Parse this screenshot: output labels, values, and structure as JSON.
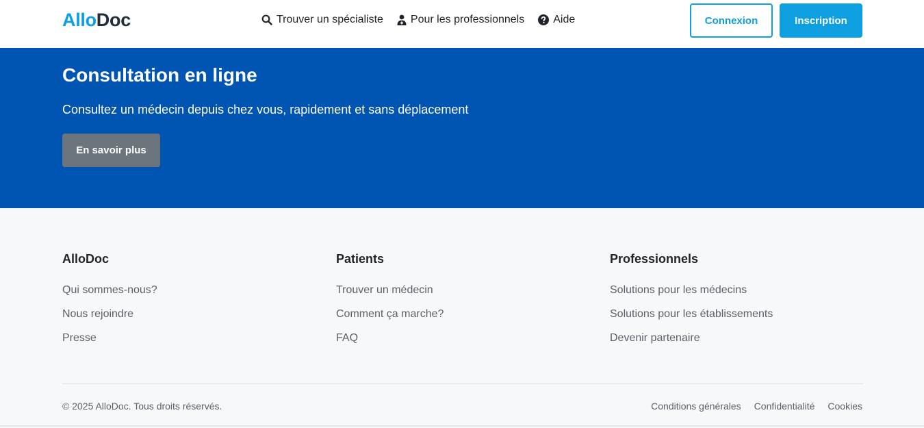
{
  "brand": {
    "part1": "Allo",
    "part2": "Doc"
  },
  "nav": {
    "find_specialist": "Trouver un spécialiste",
    "for_professionals": "Pour les professionnels",
    "help": "Aide"
  },
  "auth": {
    "login": "Connexion",
    "signup": "Inscription"
  },
  "hero": {
    "title": "Consultation en ligne",
    "subtitle": "Consultez un médecin depuis chez vous, rapidement et sans déplacement",
    "cta": "En savoir plus"
  },
  "footer": {
    "columns": [
      {
        "title": "AlloDoc",
        "links": [
          "Qui sommes-nous?",
          "Nous rejoindre",
          "Presse"
        ]
      },
      {
        "title": "Patients",
        "links": [
          "Trouver un médecin",
          "Comment ça marche?",
          "FAQ"
        ]
      },
      {
        "title": "Professionnels",
        "links": [
          "Solutions pour les médecins",
          "Solutions pour les établissements",
          "Devenir partenaire"
        ]
      }
    ],
    "copyright": "© 2025 AlloDoc. Tous droits réservés.",
    "legal": [
      "Conditions générales",
      "Confidentialité",
      "Cookies"
    ]
  },
  "colors": {
    "accent": "#0d9fe0",
    "hero_bg": "#0055b3",
    "grey_button": "#6c757d",
    "footer_bg": "#f7f8fa"
  },
  "icons": {
    "find_specialist": "search-icon",
    "for_professionals": "doctor-icon",
    "help": "question-circle-icon"
  }
}
